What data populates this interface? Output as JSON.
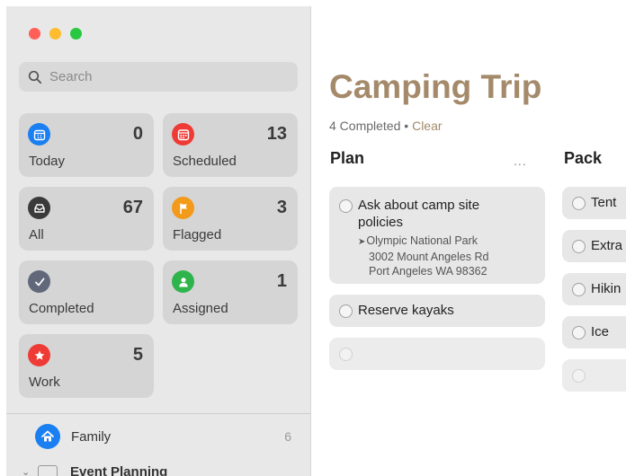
{
  "colors": {
    "accent": "#a48a6a",
    "today": "#1a7ff0",
    "scheduled": "#ef3b36",
    "all": "#3a3a3a",
    "flagged": "#f39a1a",
    "completed": "#60687a",
    "assigned": "#2fb44b",
    "work": "#ef3b36",
    "family": "#1a7ff0"
  },
  "window": {
    "controls": [
      "close",
      "minimize",
      "zoom"
    ]
  },
  "search": {
    "placeholder": "Search"
  },
  "smart_lists": [
    {
      "label": "Today",
      "count": "0",
      "icon": "calendar-icon"
    },
    {
      "label": "Scheduled",
      "count": "13",
      "icon": "calendar-grid-icon"
    },
    {
      "label": "All",
      "count": "67",
      "icon": "tray-icon"
    },
    {
      "label": "Flagged",
      "count": "3",
      "icon": "flag-icon"
    },
    {
      "label": "Completed",
      "count": "",
      "icon": "checkmark-icon"
    },
    {
      "label": "Assigned",
      "count": "1",
      "icon": "person-icon"
    },
    {
      "label": "Work",
      "count": "5",
      "icon": "star-icon"
    }
  ],
  "lists": [
    {
      "name": "Family",
      "count": "6",
      "icon": "house-icon"
    },
    {
      "name": "Event Planning",
      "icon": "folder-icon",
      "collapsed_indicator": "chevron-down-icon"
    }
  ],
  "main": {
    "title": "Camping Trip",
    "completed_text": "4 Completed",
    "separator": "•",
    "clear_label": "Clear",
    "columns": [
      {
        "name": "Plan",
        "more": "...",
        "tasks": [
          {
            "title_line1": "Ask about camp site",
            "title_line2": "policies",
            "location": {
              "line1": "Olympic National Park",
              "line2": "3002 Mount Angeles Rd",
              "line3": "Port Angeles WA 98362"
            }
          },
          {
            "title": "Reserve kayaks"
          },
          {
            "title": ""
          }
        ]
      },
      {
        "name": "Pack",
        "tasks": [
          {
            "title": "Tent"
          },
          {
            "title": "Extra"
          },
          {
            "title": "Hikin"
          },
          {
            "title": "Ice"
          },
          {
            "title": ""
          }
        ]
      }
    ]
  }
}
